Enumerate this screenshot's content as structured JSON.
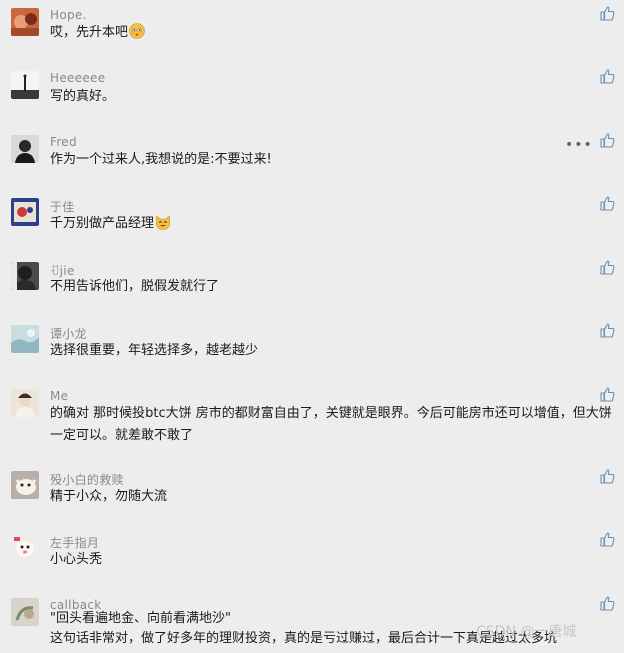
{
  "comments": [
    {
      "name": "Hope.",
      "text": "哎，先升本吧",
      "emoji": "flushed-face"
    },
    {
      "name": "Heeeeee",
      "text": "写的真好。"
    },
    {
      "name": "Fred",
      "text": "作为一个过来人,我想说的是:不要过来!",
      "more": "•••"
    },
    {
      "name": "于佳",
      "text": "千万别做产品经理",
      "emoji": "cat-face"
    },
    {
      "name": "ꀀjie",
      "text": "不用告诉他们，脱假发就行了"
    },
    {
      "name": "谭小龙",
      "text": "选择很重要，年轻选择多，越老越少"
    },
    {
      "name": "Me",
      "text": "的确对 那时候投btc大饼 房市的都财富自由了，关键就是眼界。今后可能房市还可以增值，但大饼一定可以。就差敢不敢了"
    },
    {
      "name": "殁小白的救赎",
      "text": "精于小众，勿随大流"
    },
    {
      "name": "左手指月",
      "text": "小心头秃"
    },
    {
      "name": "callback",
      "text": "\"回头看遍地金、向前看满地沙\"\n这句话非常对，做了好多年的理财投资，真的是亏过赚过，最后合计一下真是越过太多坑"
    }
  ],
  "watermark": "CSDN @一唐城",
  "colors": {
    "background": "#ededed",
    "name": "#8a8a8a",
    "text": "#1a1a1a",
    "icon": "#6b8fb5"
  }
}
